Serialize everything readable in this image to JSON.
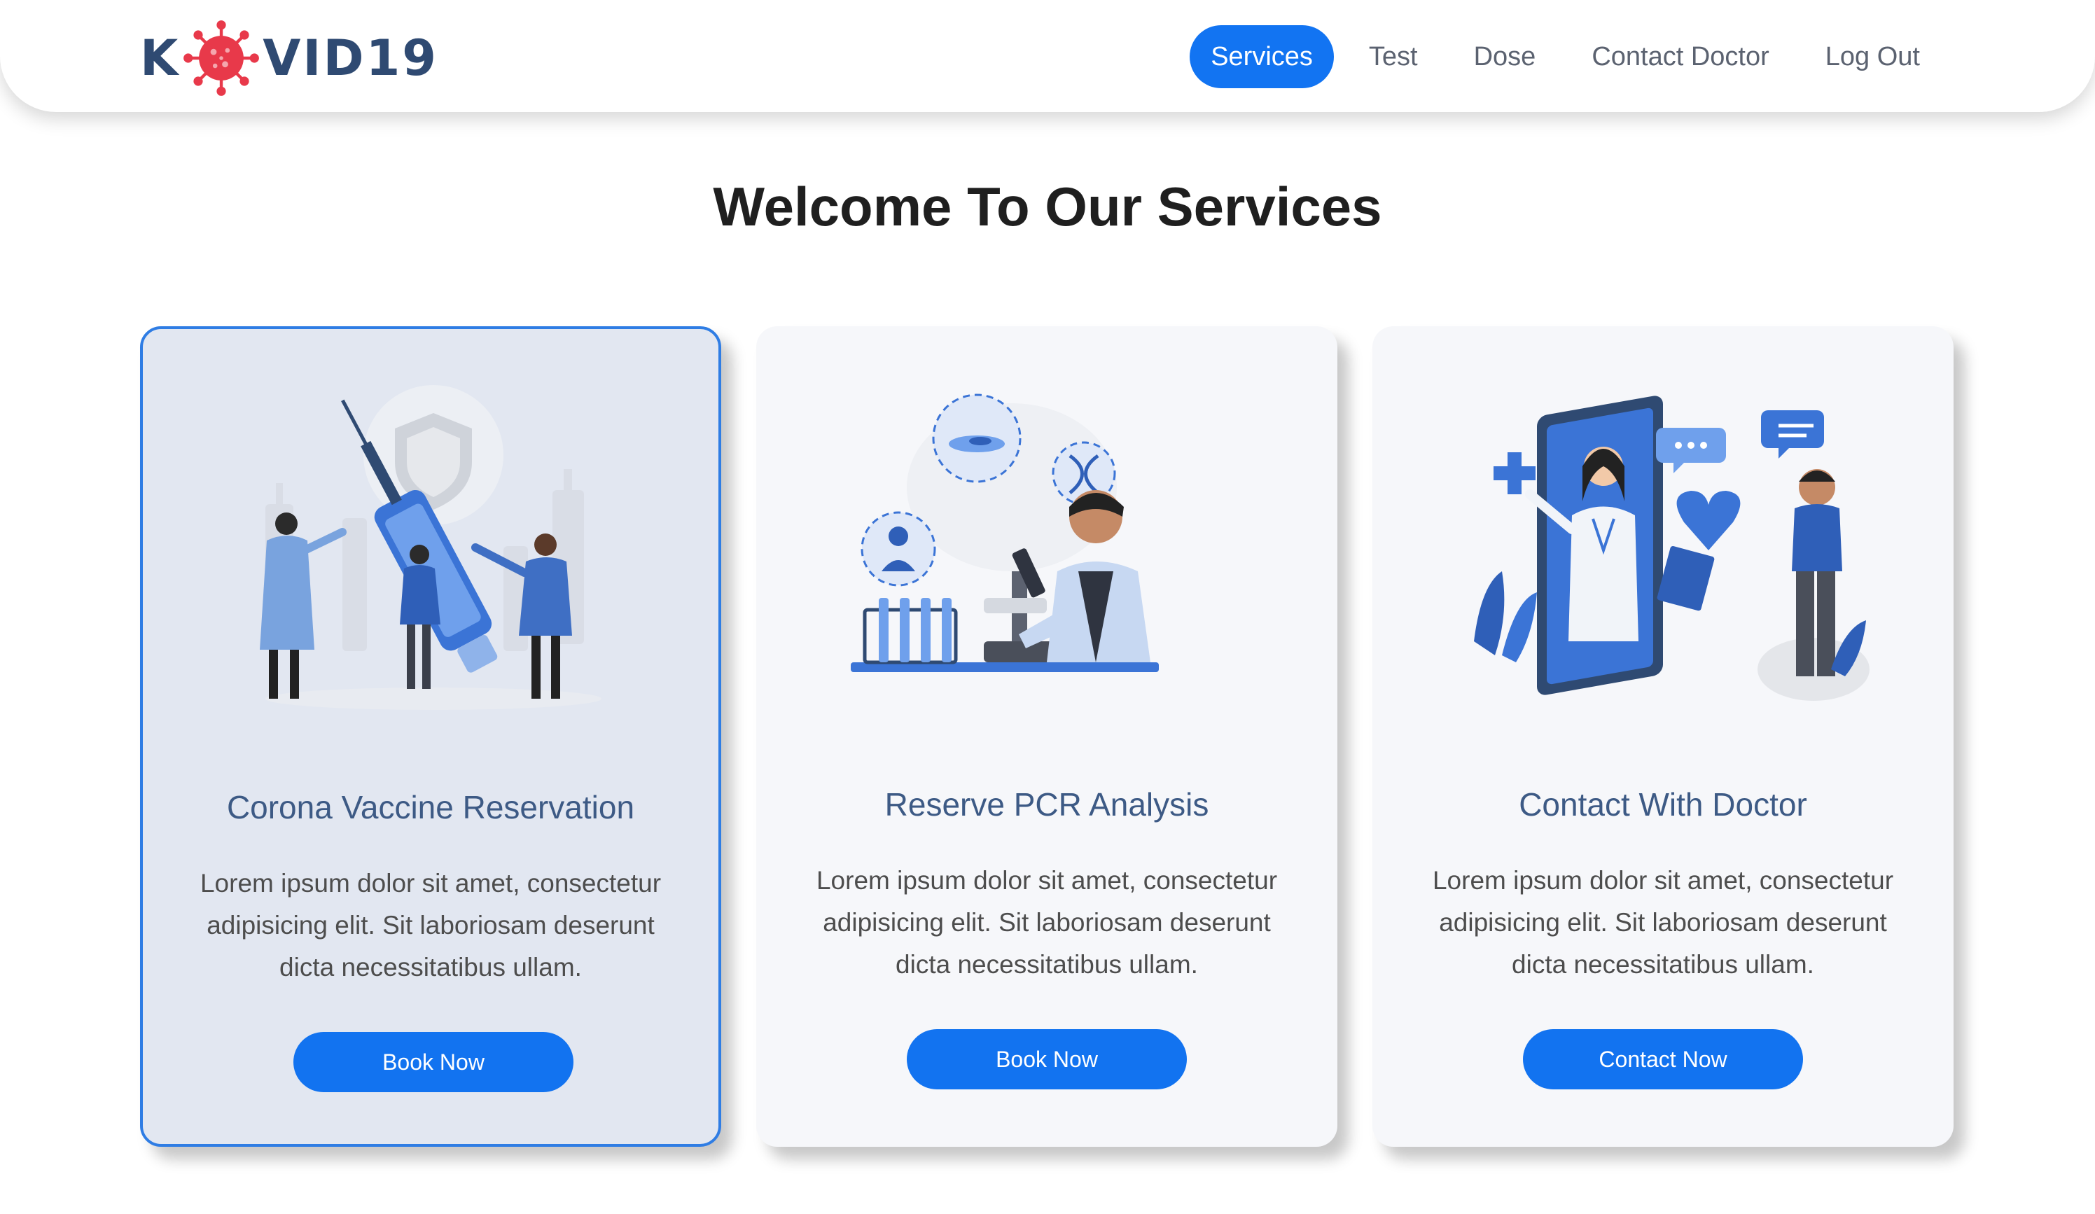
{
  "brand": {
    "logo_prefix": "K",
    "logo_suffix": "VID19"
  },
  "nav": {
    "items": [
      {
        "label": "Services",
        "active": true
      },
      {
        "label": "Test"
      },
      {
        "label": "Dose"
      },
      {
        "label": "Contact Doctor"
      },
      {
        "label": "Log Out"
      }
    ]
  },
  "page": {
    "title": "Welcome To Our Services"
  },
  "cards": [
    {
      "title": "Corona Vaccine Reservation",
      "description": "Lorem ipsum dolor sit amet, consectetur adipisicing elit. Sit laboriosam deserunt dicta necessitatibus ullam.",
      "button": "Book Now",
      "illustration": "vaccine-illustration"
    },
    {
      "title": "Reserve PCR Analysis",
      "description": "Lorem ipsum dolor sit amet, consectetur adipisicing elit. Sit laboriosam deserunt dicta necessitatibus ullam.",
      "button": "Book Now",
      "illustration": "lab-illustration"
    },
    {
      "title": "Contact With Doctor",
      "description": "Lorem ipsum dolor sit amet, consectetur adipisicing elit. Sit laboriosam deserunt dicta necessitatibus ullam.",
      "button": "Contact Now",
      "illustration": "doctor-illustration"
    }
  ],
  "colors": {
    "accent": "#1273f0",
    "logo_text": "#2f4a72",
    "virus": "#e8394a",
    "card_title": "#3d5a85",
    "selected_border": "#2f7de4"
  }
}
